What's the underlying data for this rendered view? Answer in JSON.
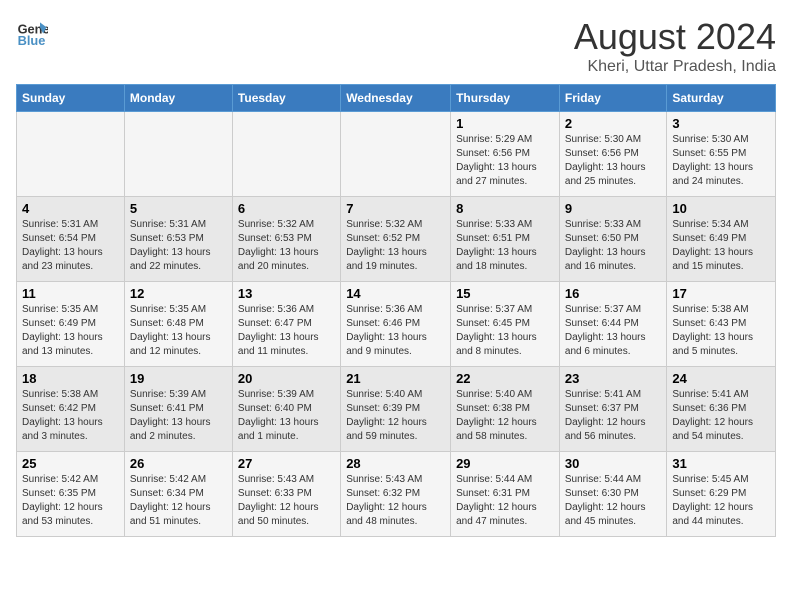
{
  "header": {
    "logo_line1": "General",
    "logo_line2": "Blue",
    "main_title": "August 2024",
    "subtitle": "Kheri, Uttar Pradesh, India"
  },
  "weekdays": [
    "Sunday",
    "Monday",
    "Tuesday",
    "Wednesday",
    "Thursday",
    "Friday",
    "Saturday"
  ],
  "weeks": [
    [
      {
        "day": "",
        "info": ""
      },
      {
        "day": "",
        "info": ""
      },
      {
        "day": "",
        "info": ""
      },
      {
        "day": "",
        "info": ""
      },
      {
        "day": "1",
        "info": "Sunrise: 5:29 AM\nSunset: 6:56 PM\nDaylight: 13 hours\nand 27 minutes."
      },
      {
        "day": "2",
        "info": "Sunrise: 5:30 AM\nSunset: 6:56 PM\nDaylight: 13 hours\nand 25 minutes."
      },
      {
        "day": "3",
        "info": "Sunrise: 5:30 AM\nSunset: 6:55 PM\nDaylight: 13 hours\nand 24 minutes."
      }
    ],
    [
      {
        "day": "4",
        "info": "Sunrise: 5:31 AM\nSunset: 6:54 PM\nDaylight: 13 hours\nand 23 minutes."
      },
      {
        "day": "5",
        "info": "Sunrise: 5:31 AM\nSunset: 6:53 PM\nDaylight: 13 hours\nand 22 minutes."
      },
      {
        "day": "6",
        "info": "Sunrise: 5:32 AM\nSunset: 6:53 PM\nDaylight: 13 hours\nand 20 minutes."
      },
      {
        "day": "7",
        "info": "Sunrise: 5:32 AM\nSunset: 6:52 PM\nDaylight: 13 hours\nand 19 minutes."
      },
      {
        "day": "8",
        "info": "Sunrise: 5:33 AM\nSunset: 6:51 PM\nDaylight: 13 hours\nand 18 minutes."
      },
      {
        "day": "9",
        "info": "Sunrise: 5:33 AM\nSunset: 6:50 PM\nDaylight: 13 hours\nand 16 minutes."
      },
      {
        "day": "10",
        "info": "Sunrise: 5:34 AM\nSunset: 6:49 PM\nDaylight: 13 hours\nand 15 minutes."
      }
    ],
    [
      {
        "day": "11",
        "info": "Sunrise: 5:35 AM\nSunset: 6:49 PM\nDaylight: 13 hours\nand 13 minutes."
      },
      {
        "day": "12",
        "info": "Sunrise: 5:35 AM\nSunset: 6:48 PM\nDaylight: 13 hours\nand 12 minutes."
      },
      {
        "day": "13",
        "info": "Sunrise: 5:36 AM\nSunset: 6:47 PM\nDaylight: 13 hours\nand 11 minutes."
      },
      {
        "day": "14",
        "info": "Sunrise: 5:36 AM\nSunset: 6:46 PM\nDaylight: 13 hours\nand 9 minutes."
      },
      {
        "day": "15",
        "info": "Sunrise: 5:37 AM\nSunset: 6:45 PM\nDaylight: 13 hours\nand 8 minutes."
      },
      {
        "day": "16",
        "info": "Sunrise: 5:37 AM\nSunset: 6:44 PM\nDaylight: 13 hours\nand 6 minutes."
      },
      {
        "day": "17",
        "info": "Sunrise: 5:38 AM\nSunset: 6:43 PM\nDaylight: 13 hours\nand 5 minutes."
      }
    ],
    [
      {
        "day": "18",
        "info": "Sunrise: 5:38 AM\nSunset: 6:42 PM\nDaylight: 13 hours\nand 3 minutes."
      },
      {
        "day": "19",
        "info": "Sunrise: 5:39 AM\nSunset: 6:41 PM\nDaylight: 13 hours\nand 2 minutes."
      },
      {
        "day": "20",
        "info": "Sunrise: 5:39 AM\nSunset: 6:40 PM\nDaylight: 13 hours\nand 1 minute."
      },
      {
        "day": "21",
        "info": "Sunrise: 5:40 AM\nSunset: 6:39 PM\nDaylight: 12 hours\nand 59 minutes."
      },
      {
        "day": "22",
        "info": "Sunrise: 5:40 AM\nSunset: 6:38 PM\nDaylight: 12 hours\nand 58 minutes."
      },
      {
        "day": "23",
        "info": "Sunrise: 5:41 AM\nSunset: 6:37 PM\nDaylight: 12 hours\nand 56 minutes."
      },
      {
        "day": "24",
        "info": "Sunrise: 5:41 AM\nSunset: 6:36 PM\nDaylight: 12 hours\nand 54 minutes."
      }
    ],
    [
      {
        "day": "25",
        "info": "Sunrise: 5:42 AM\nSunset: 6:35 PM\nDaylight: 12 hours\nand 53 minutes."
      },
      {
        "day": "26",
        "info": "Sunrise: 5:42 AM\nSunset: 6:34 PM\nDaylight: 12 hours\nand 51 minutes."
      },
      {
        "day": "27",
        "info": "Sunrise: 5:43 AM\nSunset: 6:33 PM\nDaylight: 12 hours\nand 50 minutes."
      },
      {
        "day": "28",
        "info": "Sunrise: 5:43 AM\nSunset: 6:32 PM\nDaylight: 12 hours\nand 48 minutes."
      },
      {
        "day": "29",
        "info": "Sunrise: 5:44 AM\nSunset: 6:31 PM\nDaylight: 12 hours\nand 47 minutes."
      },
      {
        "day": "30",
        "info": "Sunrise: 5:44 AM\nSunset: 6:30 PM\nDaylight: 12 hours\nand 45 minutes."
      },
      {
        "day": "31",
        "info": "Sunrise: 5:45 AM\nSunset: 6:29 PM\nDaylight: 12 hours\nand 44 minutes."
      }
    ]
  ]
}
